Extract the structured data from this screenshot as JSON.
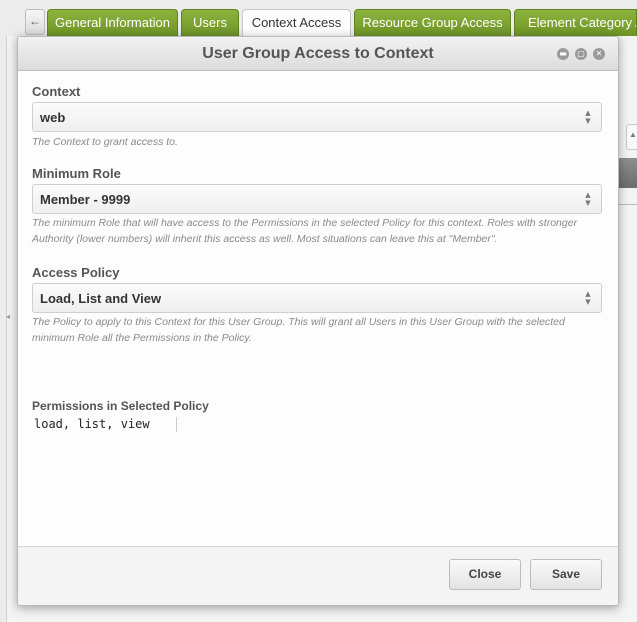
{
  "tabs": [
    {
      "label": "General Information"
    },
    {
      "label": "Users"
    },
    {
      "label": "Context Access"
    },
    {
      "label": "Resource Group Access"
    },
    {
      "label": "Element Category Access"
    }
  ],
  "modal": {
    "title": "User Group Access to Context",
    "fields": {
      "context": {
        "label": "Context",
        "value": "web",
        "help": "The Context to grant access to."
      },
      "minimum_role": {
        "label": "Minimum Role",
        "value": "Member - 9999",
        "help": "The minimum Role that will have access to the Permissions in the selected Policy for this context. Roles with stronger Authority (lower numbers) will inherit this access as well. Most situations can leave this at \"Member\"."
      },
      "access_policy": {
        "label": "Access Policy",
        "value": "Load, List and View",
        "help": "The Policy to apply to this Context for this User Group. This will grant all Users in this User Group with the selected minimum Role all the Permissions in the Policy."
      }
    },
    "permissions": {
      "label": "Permissions in Selected Policy",
      "value": "load, list, view"
    },
    "buttons": {
      "close": "Close",
      "save": "Save"
    }
  },
  "colors": {
    "tab_green": "#7ea336",
    "header_bg": "#e6e6e6"
  }
}
